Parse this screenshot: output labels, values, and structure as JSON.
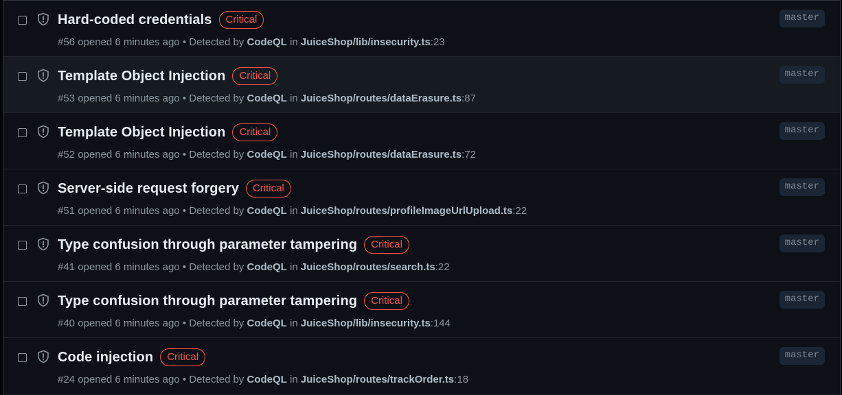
{
  "alerts": [
    {
      "title": "Hard-coded credentials",
      "severity": "Critical",
      "number": "#56",
      "opened": "opened 6 minutes ago",
      "separator": "•",
      "detected_by_label": "Detected by",
      "tool": "CodeQL",
      "in_label": "in",
      "path": "JuiceShop/lib/insecurity.ts",
      "line": ":23",
      "branch": "master"
    },
    {
      "title": "Template Object Injection",
      "severity": "Critical",
      "number": "#53",
      "opened": "opened 6 minutes ago",
      "separator": "•",
      "detected_by_label": "Detected by",
      "tool": "CodeQL",
      "in_label": "in",
      "path": "JuiceShop/routes/dataErasure.ts",
      "line": ":87",
      "branch": "master"
    },
    {
      "title": "Template Object Injection",
      "severity": "Critical",
      "number": "#52",
      "opened": "opened 6 minutes ago",
      "separator": "•",
      "detected_by_label": "Detected by",
      "tool": "CodeQL",
      "in_label": "in",
      "path": "JuiceShop/routes/dataErasure.ts",
      "line": ":72",
      "branch": "master"
    },
    {
      "title": "Server-side request forgery",
      "severity": "Critical",
      "number": "#51",
      "opened": "opened 6 minutes ago",
      "separator": "•",
      "detected_by_label": "Detected by",
      "tool": "CodeQL",
      "in_label": "in",
      "path": "JuiceShop/routes/profileImageUrlUpload.ts",
      "line": ":22",
      "branch": "master"
    },
    {
      "title": "Type confusion through parameter tampering",
      "severity": "Critical",
      "number": "#41",
      "opened": "opened 6 minutes ago",
      "separator": "•",
      "detected_by_label": "Detected by",
      "tool": "CodeQL",
      "in_label": "in",
      "path": "JuiceShop/routes/search.ts",
      "line": ":22",
      "branch": "master"
    },
    {
      "title": "Type confusion through parameter tampering",
      "severity": "Critical",
      "number": "#40",
      "opened": "opened 6 minutes ago",
      "separator": "•",
      "detected_by_label": "Detected by",
      "tool": "CodeQL",
      "in_label": "in",
      "path": "JuiceShop/lib/insecurity.ts",
      "line": ":144",
      "branch": "master"
    },
    {
      "title": "Code injection",
      "severity": "Critical",
      "number": "#24",
      "opened": "opened 6 minutes ago",
      "separator": "•",
      "detected_by_label": "Detected by",
      "tool": "CodeQL",
      "in_label": "in",
      "path": "JuiceShop/routes/trackOrder.ts",
      "line": ":18",
      "branch": "master"
    }
  ],
  "icons": {
    "alert_type": "shield-icon"
  },
  "colors": {
    "severity_critical": "#f85149",
    "background": "#0d1117",
    "hover_row": "#161b22"
  }
}
